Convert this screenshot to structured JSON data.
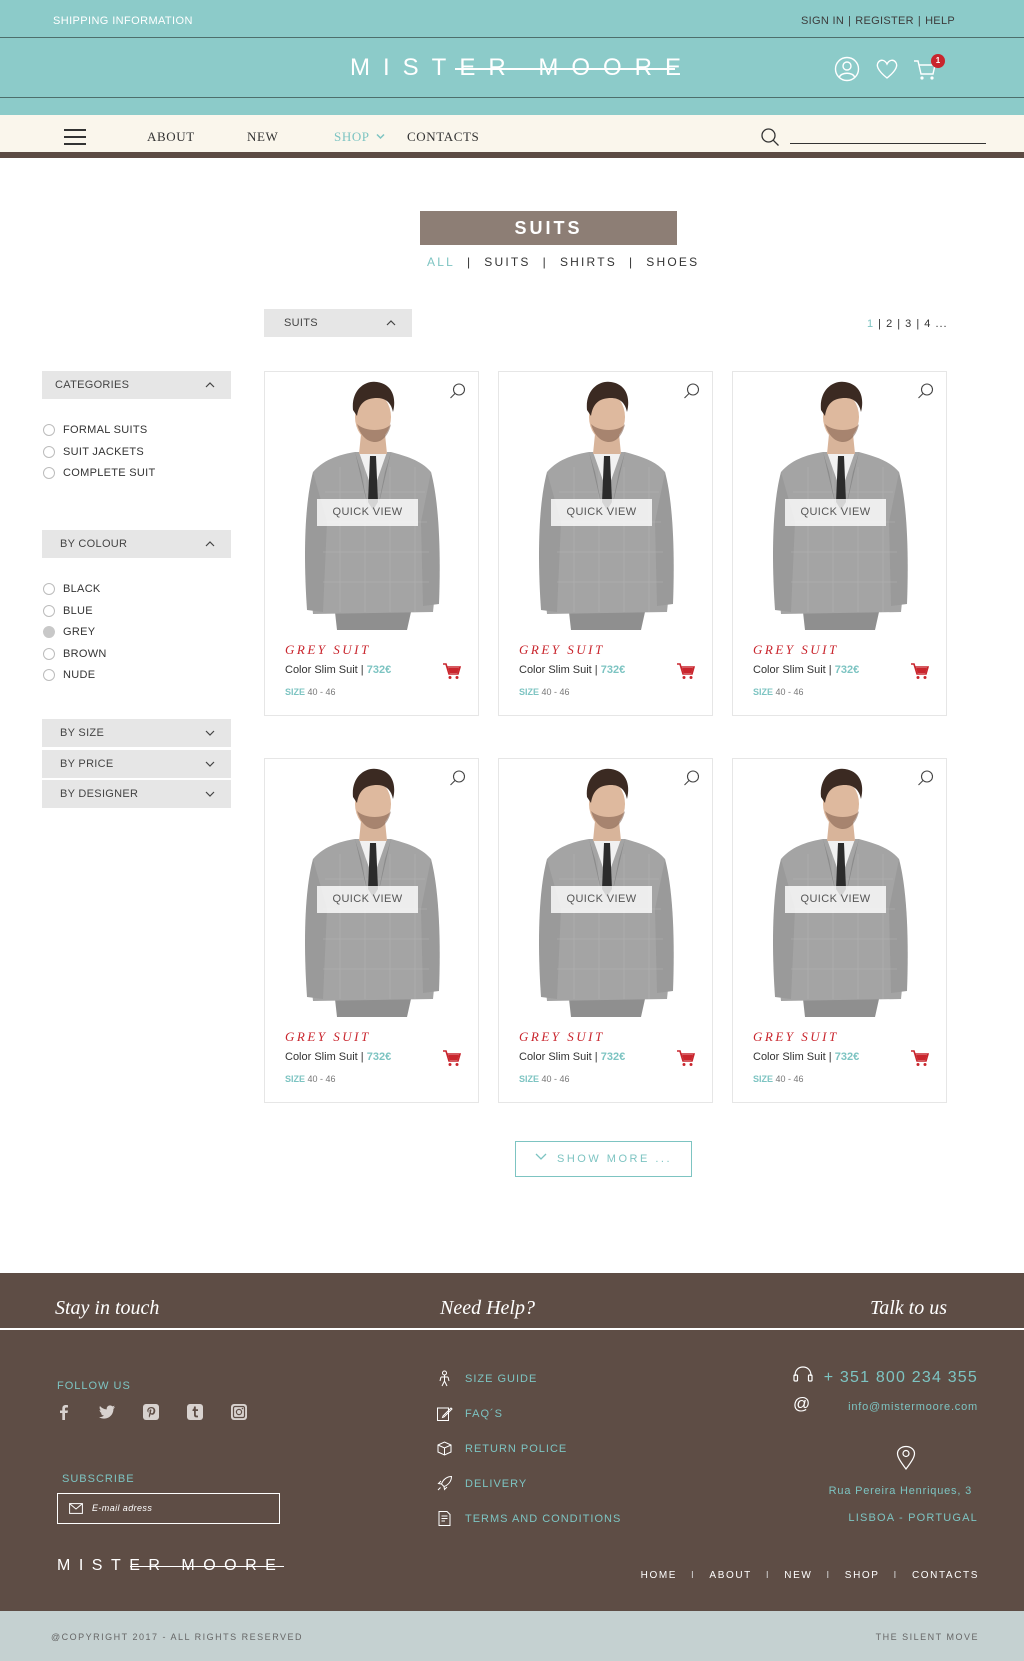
{
  "topbar": {
    "shipping": "SHIPPING INFORMATION",
    "sign_in": "SIGN IN",
    "register": "REGISTER",
    "help": "HELP",
    "sep": "|"
  },
  "brand": {
    "name": "MISTER MOORE"
  },
  "header_icons": {
    "cart_count": "1",
    "colors": {
      "badge": "#c9252d",
      "teal": "#8ccbc9"
    }
  },
  "nav": {
    "about": "ABOUT",
    "new": "NEW",
    "shop": "SHOP",
    "contacts": "CONTACTS",
    "search_value": ""
  },
  "page": {
    "title": "SUITS",
    "filters": [
      "ALL",
      "|",
      "SUITS",
      "|",
      "SHIRTS",
      "|",
      "SHOES"
    ],
    "sort_label": "SUITS",
    "pager": {
      "current": "1",
      "rest": " | 2 | 3 | 4  ..."
    }
  },
  "sidebar": {
    "categories": {
      "title": "CATEGORIES",
      "options": [
        "FORMAL SUITS",
        "SUIT JACKETS",
        "COMPLETE SUIT"
      ]
    },
    "colour": {
      "title": "BY COLOUR",
      "options": [
        "BLACK",
        "BLUE",
        "GREY",
        "BROWN",
        "NUDE"
      ],
      "selected": "GREY"
    },
    "size": {
      "title": "BY SIZE"
    },
    "price": {
      "title": "BY PRICE"
    },
    "designer": {
      "title": "BY DESIGNER"
    }
  },
  "products": [
    {
      "quick_view": "QUICK VIEW",
      "name": "GREY SUIT",
      "desc": "Color Slim Suit",
      "sep": " |",
      "price": "732€",
      "size_label": "SIZE",
      "size": "40 - 46"
    },
    {
      "quick_view": "QUICK VIEW",
      "name": "GREY SUIT",
      "desc": "Color Slim Suit",
      "sep": " |",
      "price": "732€",
      "size_label": "SIZE",
      "size": "40 - 46"
    },
    {
      "quick_view": "QUICK VIEW",
      "name": "GREY SUIT",
      "desc": "Color Slim Suit",
      "sep": " |",
      "price": "732€",
      "size_label": "SIZE",
      "size": "40 - 46"
    },
    {
      "quick_view": "QUICK VIEW",
      "name": "GREY SUIT",
      "desc": "Color Slim Suit",
      "sep": " |",
      "price": "732€",
      "size_label": "SIZE",
      "size": "40 - 46"
    },
    {
      "quick_view": "QUICK VIEW",
      "name": "GREY SUIT",
      "desc": "Color Slim Suit",
      "sep": " |",
      "price": "732€",
      "size_label": "SIZE",
      "size": "40 - 46"
    },
    {
      "quick_view": "QUICK VIEW",
      "name": "GREY SUIT",
      "desc": "Color Slim Suit",
      "sep": " |",
      "price": "732€",
      "size_label": "SIZE",
      "size": "40 - 46"
    }
  ],
  "show_more": "SHOW MORE ...",
  "footer": {
    "stay": "Stay in touch",
    "need_help": "Need Help?",
    "talk": "Talk to us",
    "follow": "FOLLOW US",
    "subscribe": "SUBSCRIBE",
    "email_placeholder": "E-mail adress",
    "help_links": [
      "SIZE GUIDE",
      "FAQ´S",
      "RETURN POLICE",
      "DELIVERY",
      "TERMS AND CONDITIONS"
    ],
    "phone": "+ 351 800 234 355",
    "email": "info@mistermoore.com",
    "address1": "Rua Pereira Henriques, 3",
    "address2": "LISBOA - PORTUGAL",
    "brand": "MISTER MOORE",
    "nav": [
      "HOME",
      "ABOUT",
      "NEW",
      "SHOP",
      "CONTACTS"
    ],
    "nav_sep": "I",
    "copyright": "@COPYRIGHT 2017 - ALL RIGHTS RESERVED",
    "credit": "THE SILENT MOVE"
  }
}
